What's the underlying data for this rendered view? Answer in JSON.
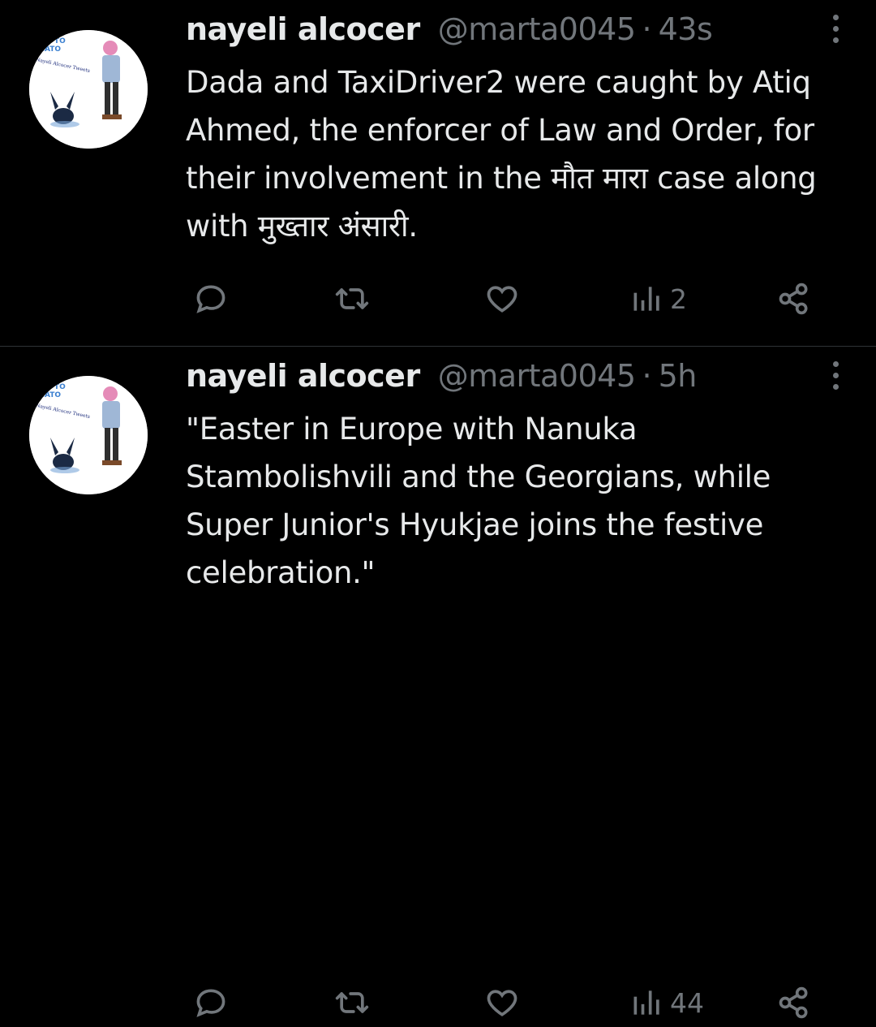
{
  "tweets": [
    {
      "author_name": "nayeli alcocer",
      "handle": "@marta0045",
      "separator": "·",
      "time": "43s",
      "text": "Dada and TaxiDriver2 were caught by Atiq Ahmed, the enforcer of Law and Order, for their involvement in the मौत मारा case along with मुख्तार अंसारी.",
      "views": "2",
      "avatar_text": [
        "TO TO",
        "MATO",
        "Nayeli Alcocer Tweets"
      ]
    },
    {
      "author_name": "nayeli alcocer",
      "handle": "@marta0045",
      "separator": "·",
      "time": "5h",
      "text": "\"Easter in Europe with Nanuka Stambolishvili and the Georgians, while Super Junior's Hyukjae joins the festive celebration.\"",
      "views": "44",
      "avatar_text": [
        "TO TO",
        "MATO",
        "Nayeli Alcocer Tweets"
      ]
    }
  ],
  "icons": {
    "reply": "reply-icon",
    "retweet": "retweet-icon",
    "like": "heart-icon",
    "views": "views-icon",
    "share": "share-icon",
    "more": "more-icon"
  },
  "colors": {
    "background": "#000000",
    "text": "#e7e9ea",
    "secondary": "#71767b",
    "divider": "#2f3336"
  }
}
